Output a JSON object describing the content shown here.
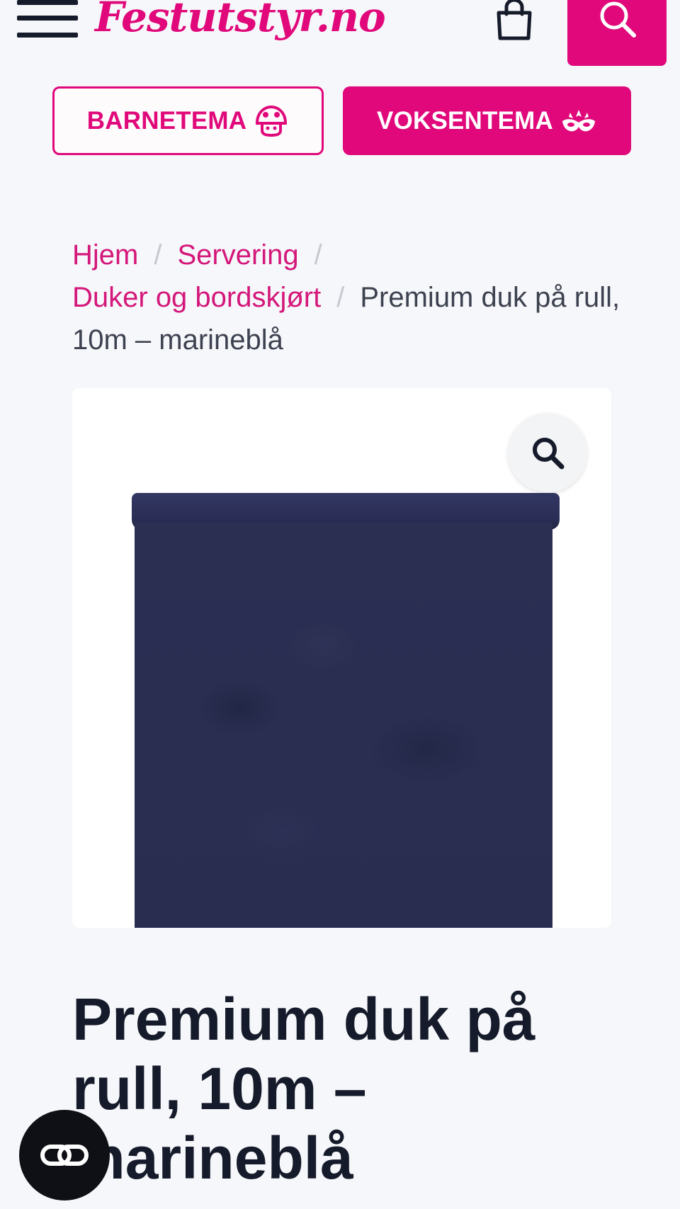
{
  "header": {
    "logo_text": "Festutstyr.no",
    "menu_icon": "hamburger-menu-icon",
    "cart_icon": "shopping-bag-icon",
    "search_icon": "search-icon",
    "brand_color": "#e0087a"
  },
  "theme_buttons": {
    "children": {
      "label": "BARNETEMA",
      "icon": "mushroom-face-icon"
    },
    "adults": {
      "label": "VOKSENTEMA",
      "icon": "masquerade-mask-icon"
    }
  },
  "breadcrumb": {
    "items": [
      {
        "label": "Hjem"
      },
      {
        "label": "Servering"
      },
      {
        "label": "Duker og bordskjørt"
      }
    ],
    "separator": "/",
    "current": "Premium duk på rull, 10m – marineblå"
  },
  "product": {
    "image_alt": "marineblå duk på rull",
    "zoom_icon": "magnifier-icon",
    "roll_color": "#2a2e52",
    "title": "Premium duk på rull, 10m – marineblå"
  },
  "chat": {
    "icon": "chat-link-icon"
  }
}
